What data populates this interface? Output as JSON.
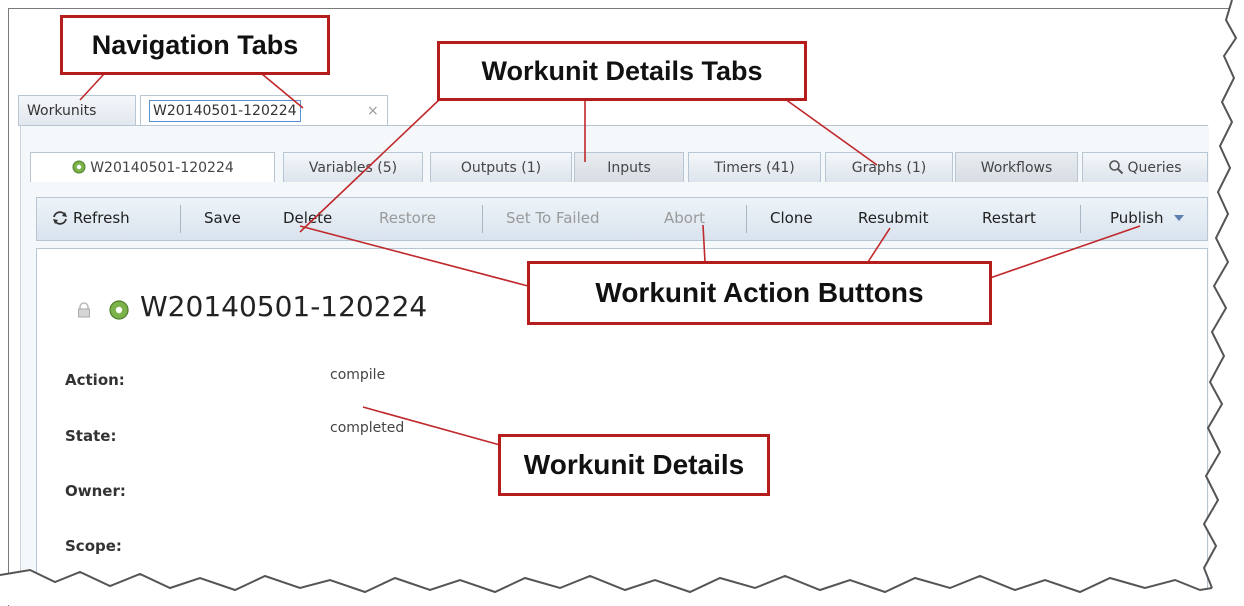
{
  "nav_tabs": {
    "workunits": "Workunits",
    "workunit": "W20140501-120224",
    "close_glyph": "×"
  },
  "details_tabs": [
    "W20140501-120224",
    "Variables (5)",
    "Outputs (1)",
    "Inputs",
    "Timers (41)",
    "Graphs (1)",
    "Workflows",
    "Queries"
  ],
  "toolbar": {
    "refresh": "Refresh",
    "save": "Save",
    "delete": "Delete",
    "restore": "Restore",
    "set_to_failed": "Set To Failed",
    "abort": "Abort",
    "clone": "Clone",
    "resubmit": "Resubmit",
    "restart": "Restart",
    "publish": "Publish"
  },
  "workunit": {
    "title": "W20140501-120224",
    "fields": [
      {
        "label": "Action:",
        "value": "compile"
      },
      {
        "label": "State:",
        "value": "completed"
      },
      {
        "label": "Owner:",
        "value": ""
      },
      {
        "label": "Scope:",
        "value": ""
      }
    ]
  },
  "annotations": {
    "navigation_tabs": "Navigation Tabs",
    "details_tabs": "Workunit Details Tabs",
    "action_buttons": "Workunit Action Buttons",
    "details": "Workunit Details"
  },
  "colors": {
    "callout_border": "#b51c1c",
    "tab_border": "#b8c5d3",
    "toolbar_bg": "#dde6ef"
  },
  "icons": [
    "gear-icon",
    "refresh-icon",
    "search-icon",
    "lock-icon",
    "chevron-down-icon",
    "close-icon"
  ]
}
